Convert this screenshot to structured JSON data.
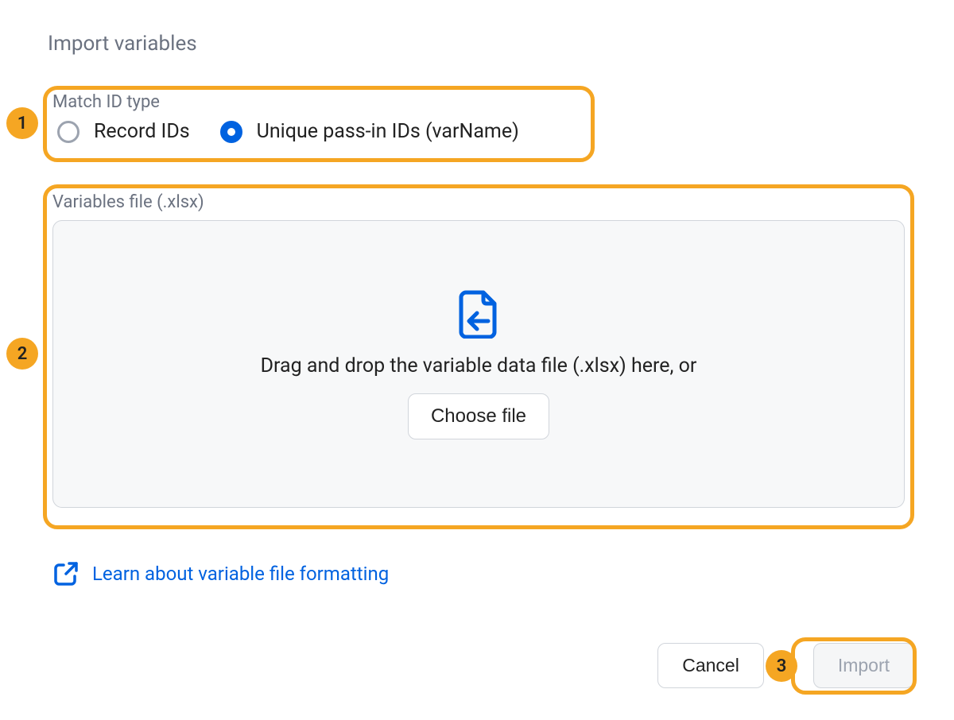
{
  "dialog": {
    "title": "Import variables"
  },
  "match": {
    "label": "Match ID type",
    "options": [
      {
        "label": "Record IDs",
        "selected": false
      },
      {
        "label": "Unique pass-in IDs (varName)",
        "selected": true
      }
    ]
  },
  "file": {
    "label": "Variables file (.xlsx)",
    "dropText": "Drag and drop the variable data file (.xlsx) here, or",
    "chooseLabel": "Choose file"
  },
  "learn": {
    "label": "Learn about variable file formatting"
  },
  "footer": {
    "cancel": "Cancel",
    "import": "Import"
  },
  "callouts": {
    "c1": "1",
    "c2": "2",
    "c3": "3"
  }
}
